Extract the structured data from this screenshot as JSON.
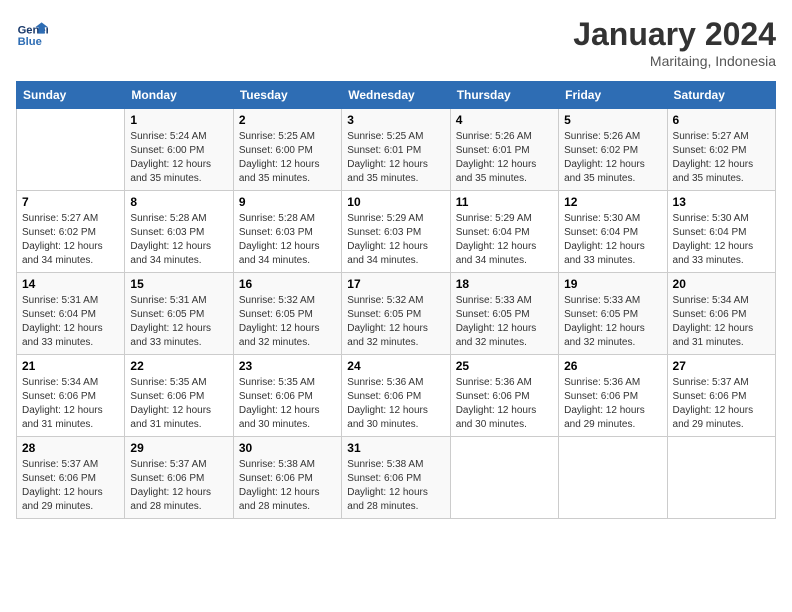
{
  "header": {
    "logo_line1": "General",
    "logo_line2": "Blue",
    "month_year": "January 2024",
    "location": "Maritaing, Indonesia"
  },
  "days_of_week": [
    "Sunday",
    "Monday",
    "Tuesday",
    "Wednesday",
    "Thursday",
    "Friday",
    "Saturday"
  ],
  "weeks": [
    [
      {
        "day": "",
        "sunrise": "",
        "sunset": "",
        "daylight": ""
      },
      {
        "day": "1",
        "sunrise": "5:24 AM",
        "sunset": "6:00 PM",
        "daylight": "12 hours and 35 minutes."
      },
      {
        "day": "2",
        "sunrise": "5:25 AM",
        "sunset": "6:00 PM",
        "daylight": "12 hours and 35 minutes."
      },
      {
        "day": "3",
        "sunrise": "5:25 AM",
        "sunset": "6:01 PM",
        "daylight": "12 hours and 35 minutes."
      },
      {
        "day": "4",
        "sunrise": "5:26 AM",
        "sunset": "6:01 PM",
        "daylight": "12 hours and 35 minutes."
      },
      {
        "day": "5",
        "sunrise": "5:26 AM",
        "sunset": "6:02 PM",
        "daylight": "12 hours and 35 minutes."
      },
      {
        "day": "6",
        "sunrise": "5:27 AM",
        "sunset": "6:02 PM",
        "daylight": "12 hours and 35 minutes."
      }
    ],
    [
      {
        "day": "7",
        "sunrise": "5:27 AM",
        "sunset": "6:02 PM",
        "daylight": "12 hours and 34 minutes."
      },
      {
        "day": "8",
        "sunrise": "5:28 AM",
        "sunset": "6:03 PM",
        "daylight": "12 hours and 34 minutes."
      },
      {
        "day": "9",
        "sunrise": "5:28 AM",
        "sunset": "6:03 PM",
        "daylight": "12 hours and 34 minutes."
      },
      {
        "day": "10",
        "sunrise": "5:29 AM",
        "sunset": "6:03 PM",
        "daylight": "12 hours and 34 minutes."
      },
      {
        "day": "11",
        "sunrise": "5:29 AM",
        "sunset": "6:04 PM",
        "daylight": "12 hours and 34 minutes."
      },
      {
        "day": "12",
        "sunrise": "5:30 AM",
        "sunset": "6:04 PM",
        "daylight": "12 hours and 33 minutes."
      },
      {
        "day": "13",
        "sunrise": "5:30 AM",
        "sunset": "6:04 PM",
        "daylight": "12 hours and 33 minutes."
      }
    ],
    [
      {
        "day": "14",
        "sunrise": "5:31 AM",
        "sunset": "6:04 PM",
        "daylight": "12 hours and 33 minutes."
      },
      {
        "day": "15",
        "sunrise": "5:31 AM",
        "sunset": "6:05 PM",
        "daylight": "12 hours and 33 minutes."
      },
      {
        "day": "16",
        "sunrise": "5:32 AM",
        "sunset": "6:05 PM",
        "daylight": "12 hours and 32 minutes."
      },
      {
        "day": "17",
        "sunrise": "5:32 AM",
        "sunset": "6:05 PM",
        "daylight": "12 hours and 32 minutes."
      },
      {
        "day": "18",
        "sunrise": "5:33 AM",
        "sunset": "6:05 PM",
        "daylight": "12 hours and 32 minutes."
      },
      {
        "day": "19",
        "sunrise": "5:33 AM",
        "sunset": "6:05 PM",
        "daylight": "12 hours and 32 minutes."
      },
      {
        "day": "20",
        "sunrise": "5:34 AM",
        "sunset": "6:06 PM",
        "daylight": "12 hours and 31 minutes."
      }
    ],
    [
      {
        "day": "21",
        "sunrise": "5:34 AM",
        "sunset": "6:06 PM",
        "daylight": "12 hours and 31 minutes."
      },
      {
        "day": "22",
        "sunrise": "5:35 AM",
        "sunset": "6:06 PM",
        "daylight": "12 hours and 31 minutes."
      },
      {
        "day": "23",
        "sunrise": "5:35 AM",
        "sunset": "6:06 PM",
        "daylight": "12 hours and 30 minutes."
      },
      {
        "day": "24",
        "sunrise": "5:36 AM",
        "sunset": "6:06 PM",
        "daylight": "12 hours and 30 minutes."
      },
      {
        "day": "25",
        "sunrise": "5:36 AM",
        "sunset": "6:06 PM",
        "daylight": "12 hours and 30 minutes."
      },
      {
        "day": "26",
        "sunrise": "5:36 AM",
        "sunset": "6:06 PM",
        "daylight": "12 hours and 29 minutes."
      },
      {
        "day": "27",
        "sunrise": "5:37 AM",
        "sunset": "6:06 PM",
        "daylight": "12 hours and 29 minutes."
      }
    ],
    [
      {
        "day": "28",
        "sunrise": "5:37 AM",
        "sunset": "6:06 PM",
        "daylight": "12 hours and 29 minutes."
      },
      {
        "day": "29",
        "sunrise": "5:37 AM",
        "sunset": "6:06 PM",
        "daylight": "12 hours and 28 minutes."
      },
      {
        "day": "30",
        "sunrise": "5:38 AM",
        "sunset": "6:06 PM",
        "daylight": "12 hours and 28 minutes."
      },
      {
        "day": "31",
        "sunrise": "5:38 AM",
        "sunset": "6:06 PM",
        "daylight": "12 hours and 28 minutes."
      },
      {
        "day": "",
        "sunrise": "",
        "sunset": "",
        "daylight": ""
      },
      {
        "day": "",
        "sunrise": "",
        "sunset": "",
        "daylight": ""
      },
      {
        "day": "",
        "sunrise": "",
        "sunset": "",
        "daylight": ""
      }
    ]
  ],
  "labels": {
    "sunrise_prefix": "Sunrise: ",
    "sunset_prefix": "Sunset: ",
    "daylight_prefix": "Daylight: "
  }
}
